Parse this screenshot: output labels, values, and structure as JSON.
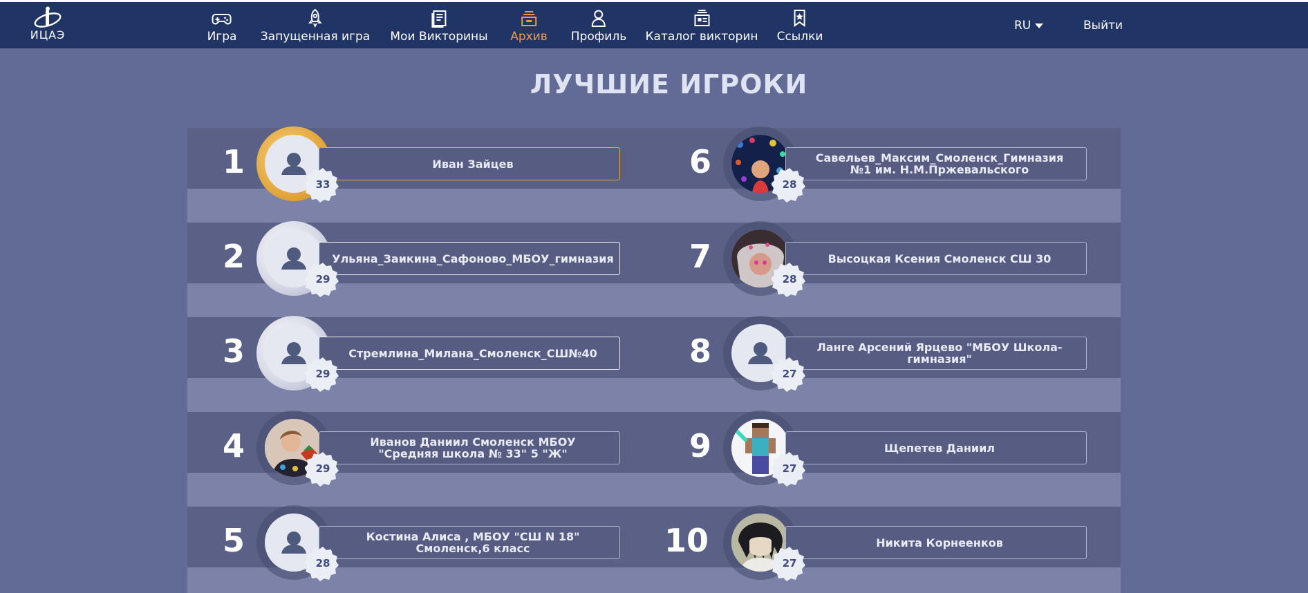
{
  "header": {
    "logo_text": "ИЦАЭ",
    "nav": [
      {
        "label": "Игра",
        "icon": "gamepad-icon"
      },
      {
        "label": "Запущенная игра",
        "icon": "rocket-icon"
      },
      {
        "label": "Мои Викторины",
        "icon": "document-icon"
      },
      {
        "label": "Архив",
        "icon": "archive-icon",
        "active": true
      },
      {
        "label": "Профиль",
        "icon": "user-icon"
      },
      {
        "label": "Каталог викторин",
        "icon": "catalog-icon"
      },
      {
        "label": "Ссылки",
        "icon": "bookmark-star-icon"
      }
    ],
    "language": "RU",
    "logout_label": "Выйти",
    "active_color": "#f09a46"
  },
  "page": {
    "title": "ЛУЧШИЕ ИГРОКИ"
  },
  "leaders": [
    {
      "rank": "1",
      "name": "Иван Зайцев",
      "score": "33",
      "medal": "gold",
      "avatar": "default-avatar-icon"
    },
    {
      "rank": "2",
      "name": "Ульяна_Заикина_Сафоново_МБОУ_гимназия",
      "score": "29",
      "medal": "silver",
      "avatar": "default-avatar-icon"
    },
    {
      "rank": "3",
      "name": "Стремлина_Милана_Смоленск_СШ№40",
      "score": "29",
      "medal": "silver",
      "avatar": "default-avatar-icon"
    },
    {
      "rank": "4",
      "name": "Иванов Даниил Смоленск МБОУ \"Средняя школа № 33\" 5 \"Ж\"",
      "score": "29",
      "medal": "none",
      "avatar": "photo-boy"
    },
    {
      "rank": "5",
      "name": "Костина Алиса , МБОУ \"СШ N 18\" Смоленск,6 класс",
      "score": "28",
      "medal": "none",
      "avatar": "default-avatar-icon"
    },
    {
      "rank": "6",
      "name": "Савельев_Максим_Смоленск_Гимназия №1 им. Н.М.Пржевальского",
      "score": "28",
      "medal": "none",
      "avatar": "photo-lights"
    },
    {
      "rank": "7",
      "name": "Высоцкая Ксения Смоленск СШ 30",
      "score": "28",
      "medal": "none",
      "avatar": "photo-girl"
    },
    {
      "rank": "8",
      "name": "Ланге Арсений Ярцево \"МБОУ Школа-гимназия\"",
      "score": "27",
      "medal": "none",
      "avatar": "default-avatar-icon"
    },
    {
      "rank": "9",
      "name": "Щепетев Даниил",
      "score": "27",
      "medal": "none",
      "avatar": "minecraft-character"
    },
    {
      "rank": "10",
      "name": "Никита Корнеенков",
      "score": "27",
      "medal": "none",
      "avatar": "anime-character"
    }
  ]
}
